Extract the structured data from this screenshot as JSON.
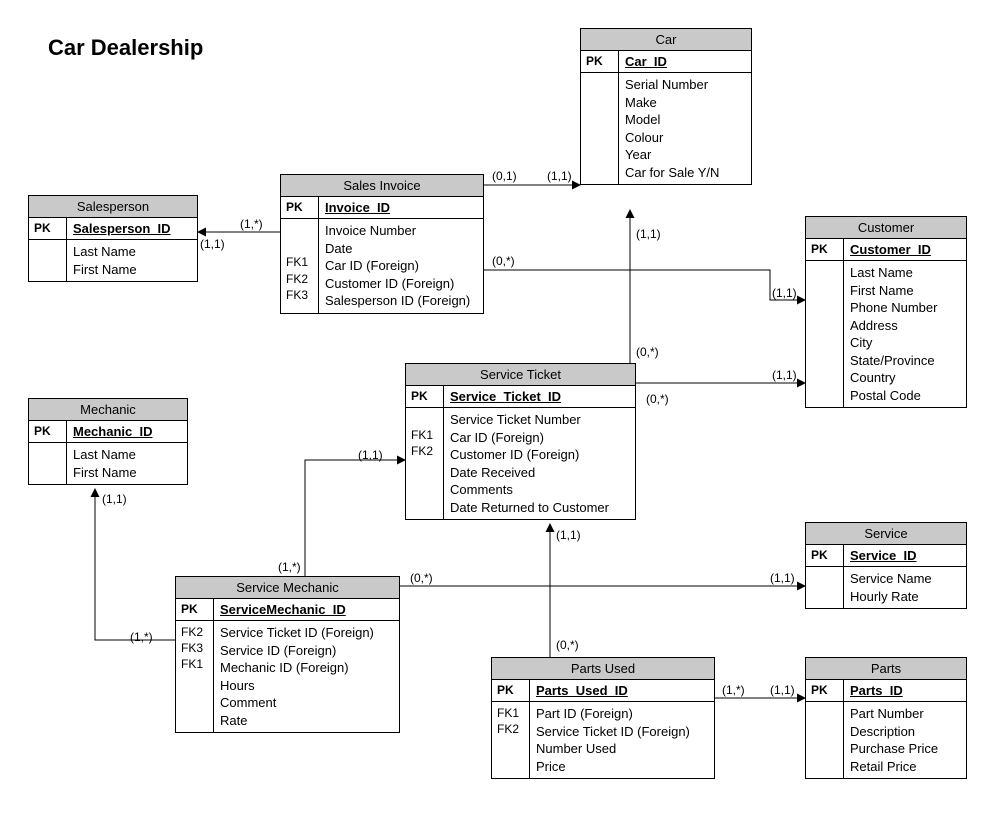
{
  "title": "Car Dealership",
  "entities": {
    "salesperson": {
      "name": "Salesperson",
      "pk": "Salesperson_ID",
      "attrs": [
        "Last Name",
        "First Name"
      ],
      "fks": []
    },
    "salesInvoice": {
      "name": "Sales Invoice",
      "pk": "Invoice_ID",
      "attrs": [
        "Invoice Number",
        "Date",
        "Car ID (Foreign)",
        "Customer ID (Foreign)",
        "Salesperson ID (Foreign)"
      ],
      "fks": [
        "",
        "",
        "FK1",
        "FK2",
        "FK3"
      ]
    },
    "car": {
      "name": "Car",
      "pk": "Car_ID",
      "attrs": [
        "Serial Number",
        "Make",
        "Model",
        "Colour",
        "Year",
        "Car for Sale Y/N"
      ],
      "fks": []
    },
    "customer": {
      "name": "Customer",
      "pk": "Customer_ID",
      "attrs": [
        "Last Name",
        "First Name",
        "Phone Number",
        "Address",
        "City",
        "State/Province",
        "Country",
        "Postal Code"
      ],
      "fks": []
    },
    "mechanic": {
      "name": "Mechanic",
      "pk": "Mechanic_ID",
      "attrs": [
        "Last Name",
        "First Name"
      ],
      "fks": []
    },
    "serviceTicket": {
      "name": "Service Ticket",
      "pk": "Service_Ticket_ID",
      "attrs": [
        "Service Ticket Number",
        "Car ID (Foreign)",
        "Customer ID (Foreign)",
        "Date Received",
        "Comments",
        "Date Returned to Customer"
      ],
      "fks": [
        "",
        "FK1",
        "FK2",
        "",
        "",
        ""
      ]
    },
    "service": {
      "name": "Service",
      "pk": "Service_ID",
      "attrs": [
        "Service Name",
        "Hourly Rate"
      ],
      "fks": []
    },
    "serviceMechanic": {
      "name": "Service Mechanic",
      "pk": "ServiceMechanic_ID",
      "attrs": [
        "Service Ticket ID (Foreign)",
        "Service ID (Foreign)",
        "Mechanic ID (Foreign)",
        "Hours",
        "Comment",
        "Rate"
      ],
      "fks": [
        "FK2",
        "FK3",
        "FK1",
        "",
        "",
        ""
      ]
    },
    "partsUsed": {
      "name": "Parts Used",
      "pk": "Parts_Used_ID",
      "attrs": [
        "Part ID (Foreign)",
        "Service Ticket ID (Foreign)",
        "Number Used",
        "Price"
      ],
      "fks": [
        "FK1",
        "FK2",
        "",
        ""
      ]
    },
    "parts": {
      "name": "Parts",
      "pk": "Parts_ID",
      "attrs": [
        "Part Number",
        "Description",
        "Purchase Price",
        "Retail Price"
      ],
      "fks": []
    }
  },
  "cards": {
    "si_sp_left": "(1,*)",
    "si_sp_right": "(1,1)",
    "si_car_left": "(0,1)",
    "si_car_right": "(1,1)",
    "si_cust_left": "(0,*)",
    "si_cust_right": "(1,1)",
    "st_car_bottom": "(0,*)",
    "st_car_top": "(1,1)",
    "st_cust_left": "(0,*)",
    "st_cust_right": "(1,1)",
    "sm_st_bottom": "(1,*)",
    "sm_st_top": "(1,1)",
    "sm_mech_bottom": "(1,*)",
    "sm_mech_top": "(1,1)",
    "sm_svc_left": "(0,*)",
    "sm_svc_right": "(1,1)",
    "pu_st_bottom": "(0,*)",
    "pu_st_top": "(1,1)",
    "pu_parts_left": "(1,*)",
    "pu_parts_right": "(1,1)"
  }
}
